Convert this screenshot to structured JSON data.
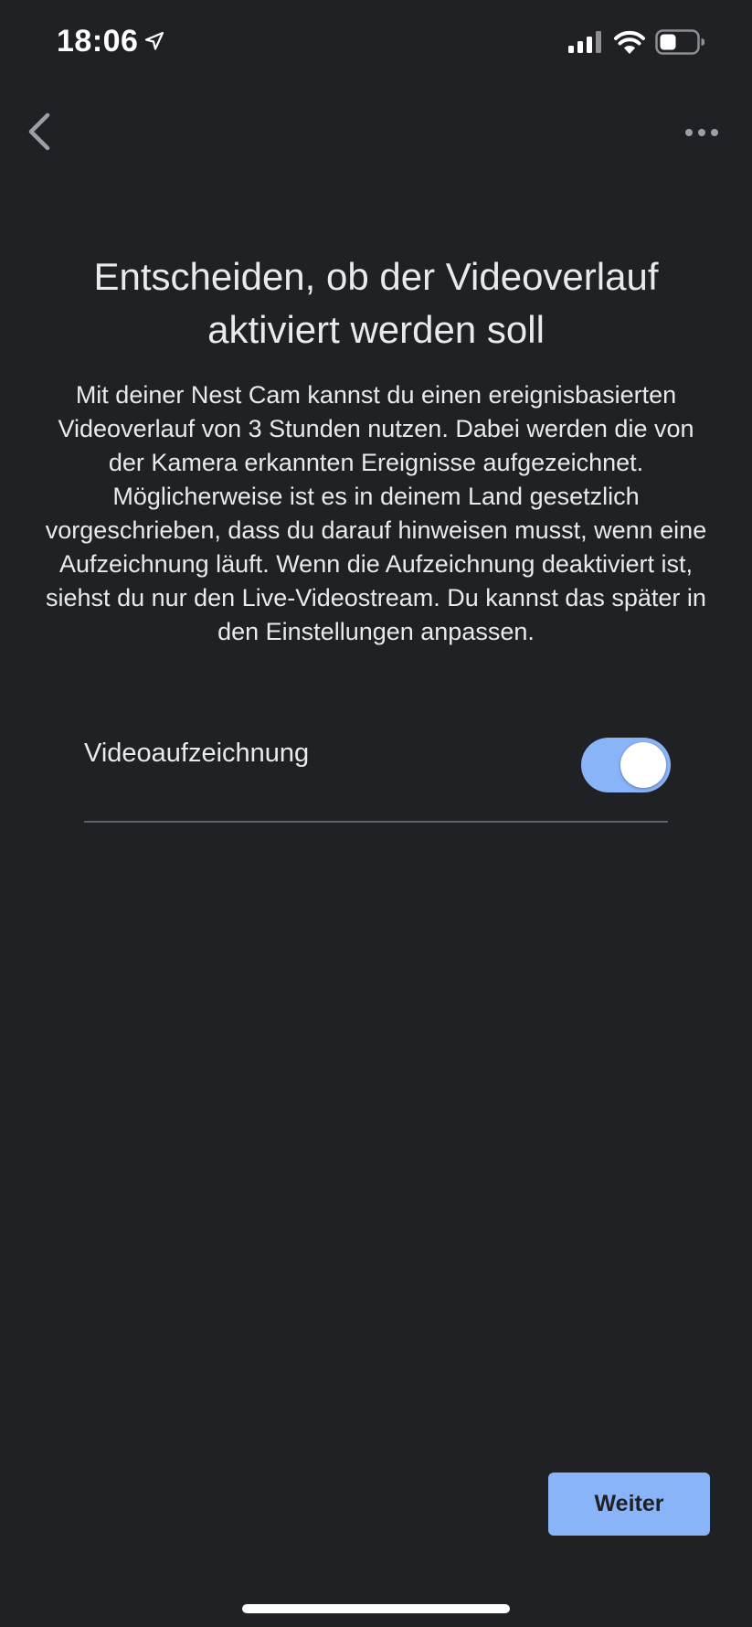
{
  "status_bar": {
    "time": "18:06",
    "icons": [
      "location-arrow-icon",
      "cellular-signal-icon",
      "wifi-icon",
      "battery-icon"
    ]
  },
  "header": {
    "back_icon": "chevron-left-icon",
    "more_icon": "more-horizontal-icon"
  },
  "content": {
    "title": "Entscheiden, ob der Videoverlauf aktiviert werden soll",
    "description": "Mit deiner Nest Cam kannst du einen ereignisbasierten Videoverlauf von 3 Stunden nutzen. Dabei werden die von der Kamera erkannten Ereignisse aufgezeichnet. Möglicherweise ist es in deinem Land gesetzlich vorgeschrieben, dass du darauf hinweisen musst, wenn eine Aufzeichnung läuft. Wenn die Aufzeichnung deaktiviert ist, siehst du nur den Live-Videostream. Du kannst das später in den Einstellungen anpassen."
  },
  "setting": {
    "label": "Videoaufzeichnung",
    "enabled": true
  },
  "footer": {
    "next_label": "Weiter"
  },
  "colors": {
    "background": "#202124",
    "text": "#e8eaed",
    "accent": "#8ab4f8",
    "divider": "#5f6368"
  }
}
